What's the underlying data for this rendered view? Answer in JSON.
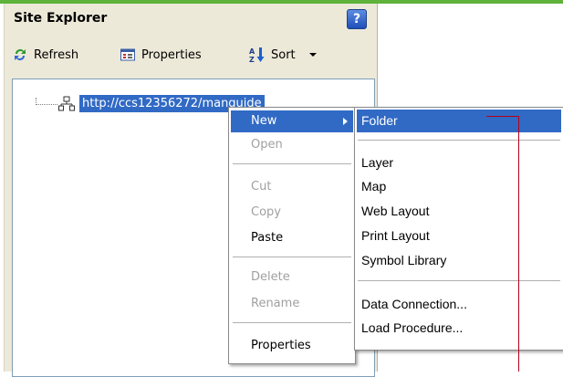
{
  "panel": {
    "title": "Site Explorer",
    "help_label": "?"
  },
  "toolbar": {
    "refresh_label": "Refresh",
    "properties_label": "Properties",
    "sort_label": "Sort"
  },
  "tree": {
    "node_label": "http://ccs12356272/manguide"
  },
  "context_menu": {
    "items": [
      {
        "label": "New",
        "state": "highlighted"
      },
      {
        "label": "Open",
        "state": "disabled"
      },
      {
        "label": "Cut",
        "state": "disabled"
      },
      {
        "label": "Copy",
        "state": "disabled"
      },
      {
        "label": "Paste",
        "state": "enabled"
      },
      {
        "label": "Delete",
        "state": "disabled"
      },
      {
        "label": "Rename",
        "state": "disabled"
      },
      {
        "label": "Properties",
        "state": "enabled"
      }
    ]
  },
  "submenu": {
    "items": [
      {
        "label": "Folder",
        "state": "highlighted"
      },
      {
        "label": "Layer"
      },
      {
        "label": "Map"
      },
      {
        "label": "Web Layout"
      },
      {
        "label": "Print Layout"
      },
      {
        "label": "Symbol Library"
      },
      {
        "label": "Data Connection..."
      },
      {
        "label": "Load Procedure..."
      }
    ]
  },
  "colors": {
    "highlight": "#316ac5",
    "accent_bar": "#5fb33a",
    "callout_line": "#b3001b"
  }
}
